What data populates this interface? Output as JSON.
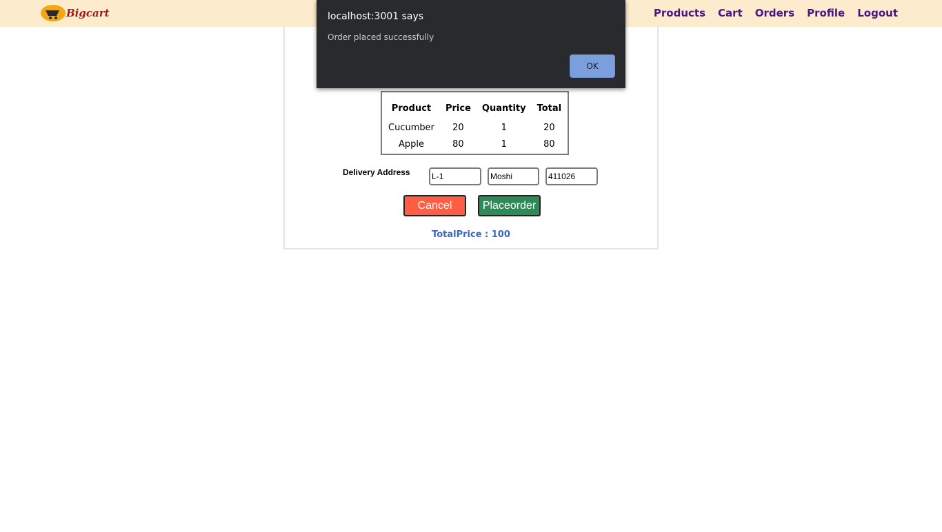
{
  "navbar": {
    "brand_name": "Bigcart",
    "brand_icon": "cart-icon",
    "links": [
      {
        "label": "Products"
      },
      {
        "label": "Cart"
      },
      {
        "label": "Orders"
      },
      {
        "label": "Profile"
      },
      {
        "label": "Logout"
      }
    ]
  },
  "order": {
    "headers": [
      "Product",
      "Price",
      "Quantity",
      "Total"
    ],
    "rows": [
      [
        "Cucumber",
        "20",
        "1",
        "20"
      ],
      [
        "Apple",
        "80",
        "1",
        "80"
      ]
    ],
    "delivery_label": "Delivery Address",
    "address": {
      "line1": "L-1",
      "city": "Moshi",
      "pincode": "411026"
    },
    "cancel_label": "Cancel",
    "place_label": "Placeorder",
    "total_text": "TotalPrice : 100"
  },
  "alert": {
    "title": "localhost:3001 says",
    "message": "Order placed successfully",
    "ok_label": "OK"
  },
  "colors": {
    "navbar_bg": "#fdebcd",
    "nav_link": "#4b1587",
    "brand": "#9b1c1c",
    "cancel": "#ff5e45",
    "place": "#2e8b57",
    "total": "#3a66c4",
    "alert_bg": "#292a2d",
    "alert_ok": "#7a9fdc"
  }
}
